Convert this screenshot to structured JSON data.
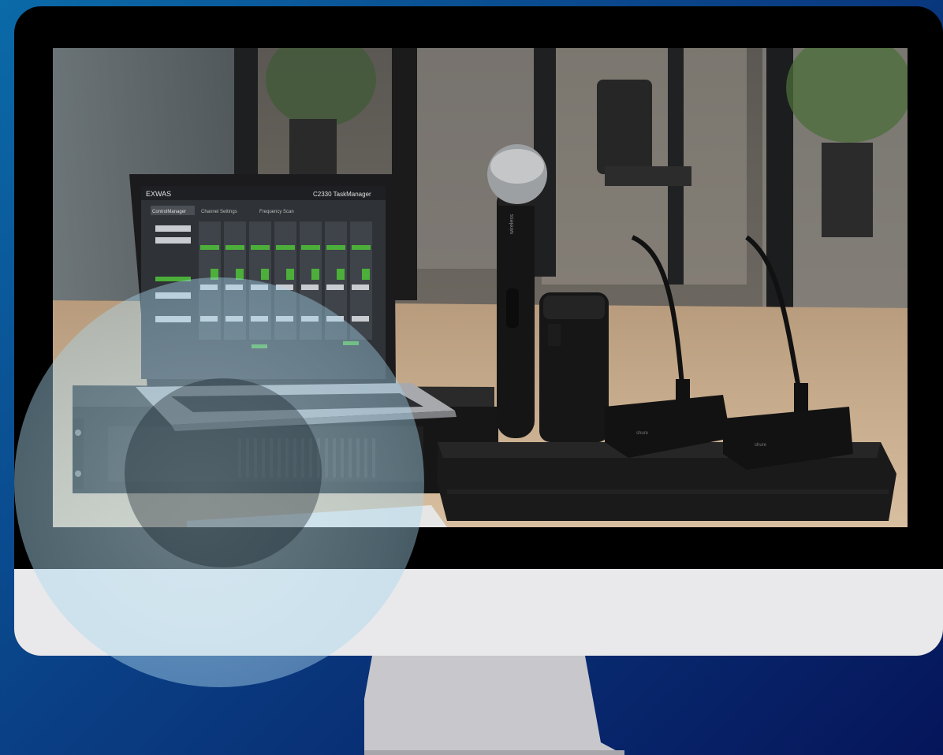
{
  "scene": {
    "laptop": {
      "app_title": "EXWAS",
      "header_right": "C2330  TaskManager",
      "tabs": [
        "ControlManager",
        "Channel Settings",
        "Frequency Scan"
      ]
    },
    "handheld_mic_label": "wireless",
    "gooseneck_labels": [
      "shure",
      "shure"
    ]
  },
  "colors": {
    "background_start": "#0b6aa8",
    "background_end": "#06155a",
    "bezel": "#000000",
    "chin": "#e9e9eb",
    "stand": "#c8c8cc",
    "accent_green": "#4caf3a"
  },
  "icons": [
    "monitor-icon"
  ]
}
